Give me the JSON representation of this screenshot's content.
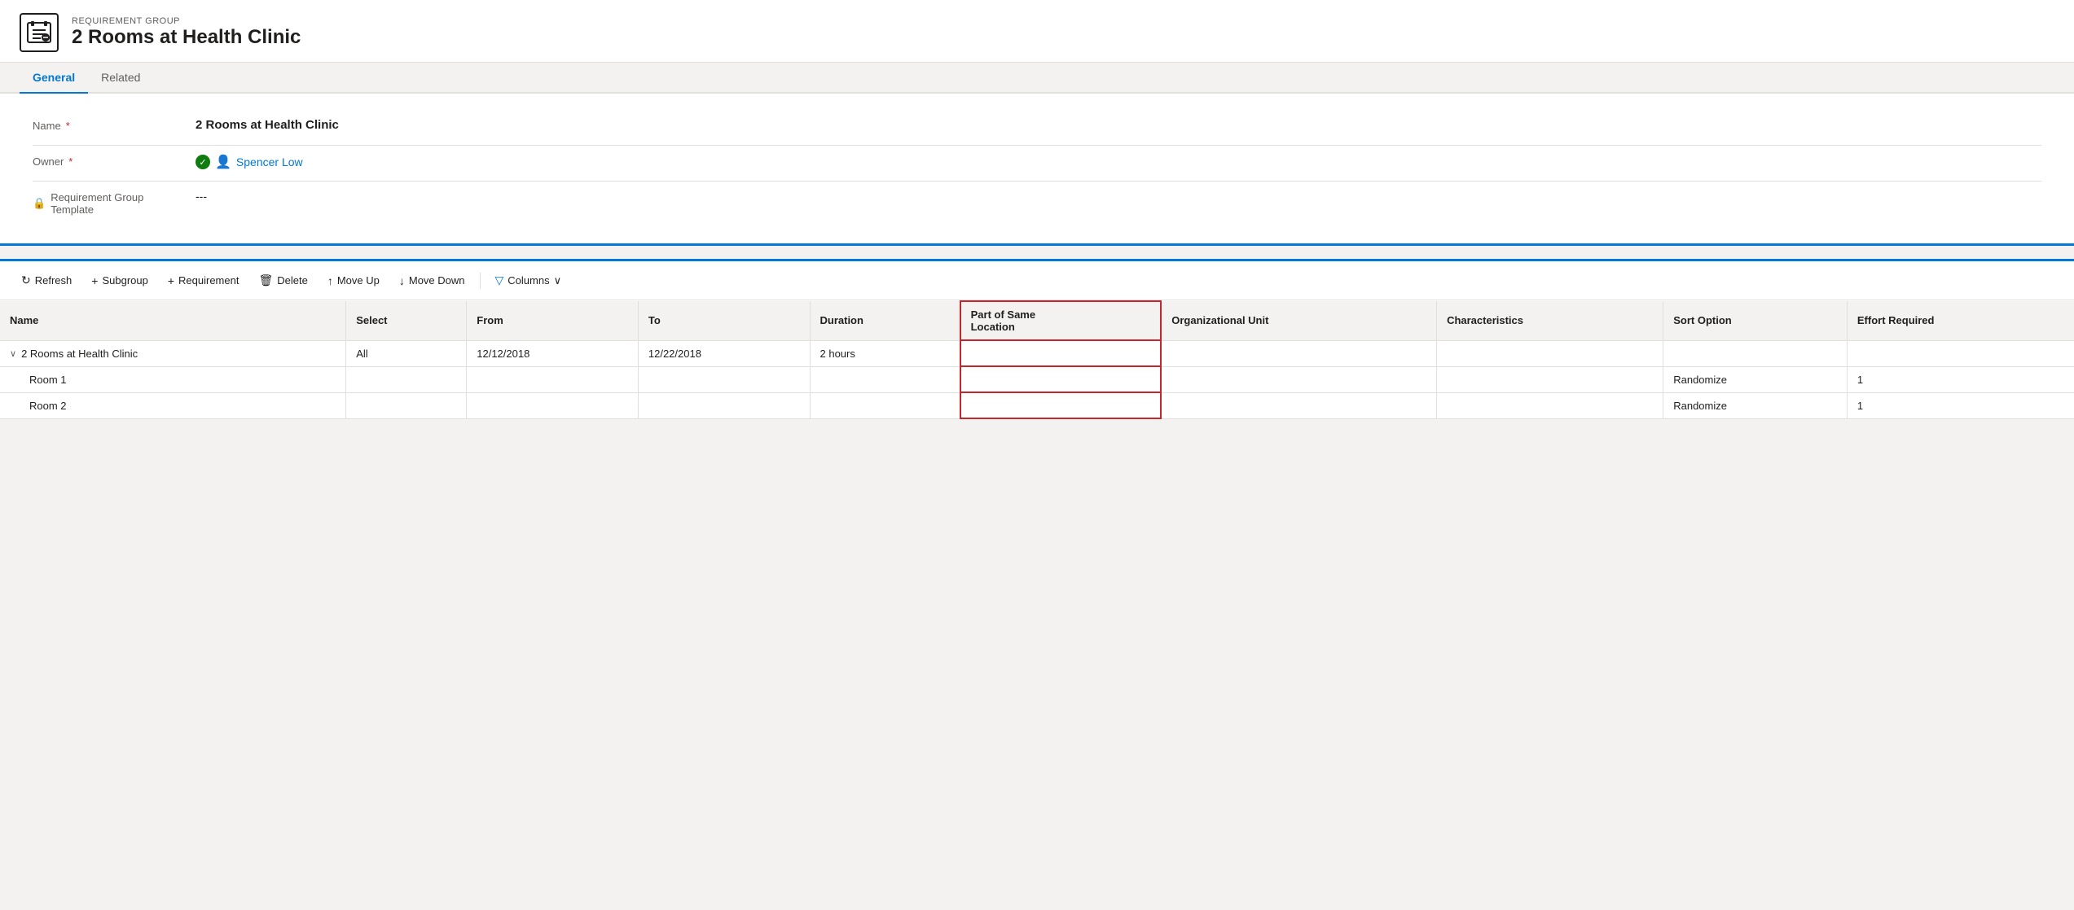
{
  "header": {
    "subtitle": "REQUIREMENT GROUP",
    "title": "2 Rooms at Health Clinic",
    "icon": "📋"
  },
  "tabs": [
    {
      "label": "General",
      "active": true
    },
    {
      "label": "Related",
      "active": false
    }
  ],
  "form": {
    "fields": [
      {
        "label": "Name",
        "required": true,
        "value": "2 Rooms at Health Clinic",
        "type": "text"
      },
      {
        "label": "Owner",
        "required": true,
        "value": "Spencer Low",
        "type": "owner"
      },
      {
        "label": "Requirement Group Template",
        "required": false,
        "value": "---",
        "type": "text",
        "hasLock": true
      }
    ]
  },
  "toolbar": {
    "buttons": [
      {
        "label": "Refresh",
        "icon": "↻",
        "disabled": false
      },
      {
        "label": "Subgroup",
        "icon": "+",
        "disabled": false
      },
      {
        "label": "Requirement",
        "icon": "+",
        "disabled": false
      },
      {
        "label": "Delete",
        "icon": "🗑",
        "disabled": false
      },
      {
        "label": "Move Up",
        "icon": "↑",
        "disabled": false
      },
      {
        "label": "Move Down",
        "icon": "↓",
        "disabled": false
      },
      {
        "label": "Columns",
        "icon": "▽",
        "disabled": false,
        "hasFilter": true
      }
    ]
  },
  "table": {
    "columns": [
      {
        "key": "name",
        "label": "Name"
      },
      {
        "key": "select",
        "label": "Select"
      },
      {
        "key": "from",
        "label": "From"
      },
      {
        "key": "to",
        "label": "To"
      },
      {
        "key": "duration",
        "label": "Duration"
      },
      {
        "key": "part_of_same",
        "label": "Part of Same",
        "sub": "Location",
        "highlighted": true
      },
      {
        "key": "org_unit",
        "label": "Organizational Unit"
      },
      {
        "key": "characteristics",
        "label": "Characteristics"
      },
      {
        "key": "sort_option",
        "label": "Sort Option"
      },
      {
        "key": "effort_required",
        "label": "Effort Required"
      }
    ],
    "rows": [
      {
        "name": "2 Rooms at Health Clinic",
        "isGroup": true,
        "select": "All",
        "from": "12/12/2018",
        "to": "12/22/2018",
        "duration": "2 hours",
        "part_of_same": "",
        "org_unit": "",
        "characteristics": "",
        "sort_option": "",
        "effort_required": ""
      },
      {
        "name": "Room 1",
        "isGroup": false,
        "select": "",
        "from": "",
        "to": "",
        "duration": "",
        "part_of_same": "",
        "org_unit": "",
        "characteristics": "",
        "sort_option": "Randomize",
        "effort_required": "1"
      },
      {
        "name": "Room 2",
        "isGroup": false,
        "select": "",
        "from": "",
        "to": "",
        "duration": "",
        "part_of_same": "",
        "org_unit": "",
        "characteristics": "",
        "sort_option": "Randomize",
        "effort_required": "1"
      }
    ]
  },
  "colors": {
    "accent": "#0078d4",
    "error": "#c4262e",
    "success": "#107c10"
  }
}
